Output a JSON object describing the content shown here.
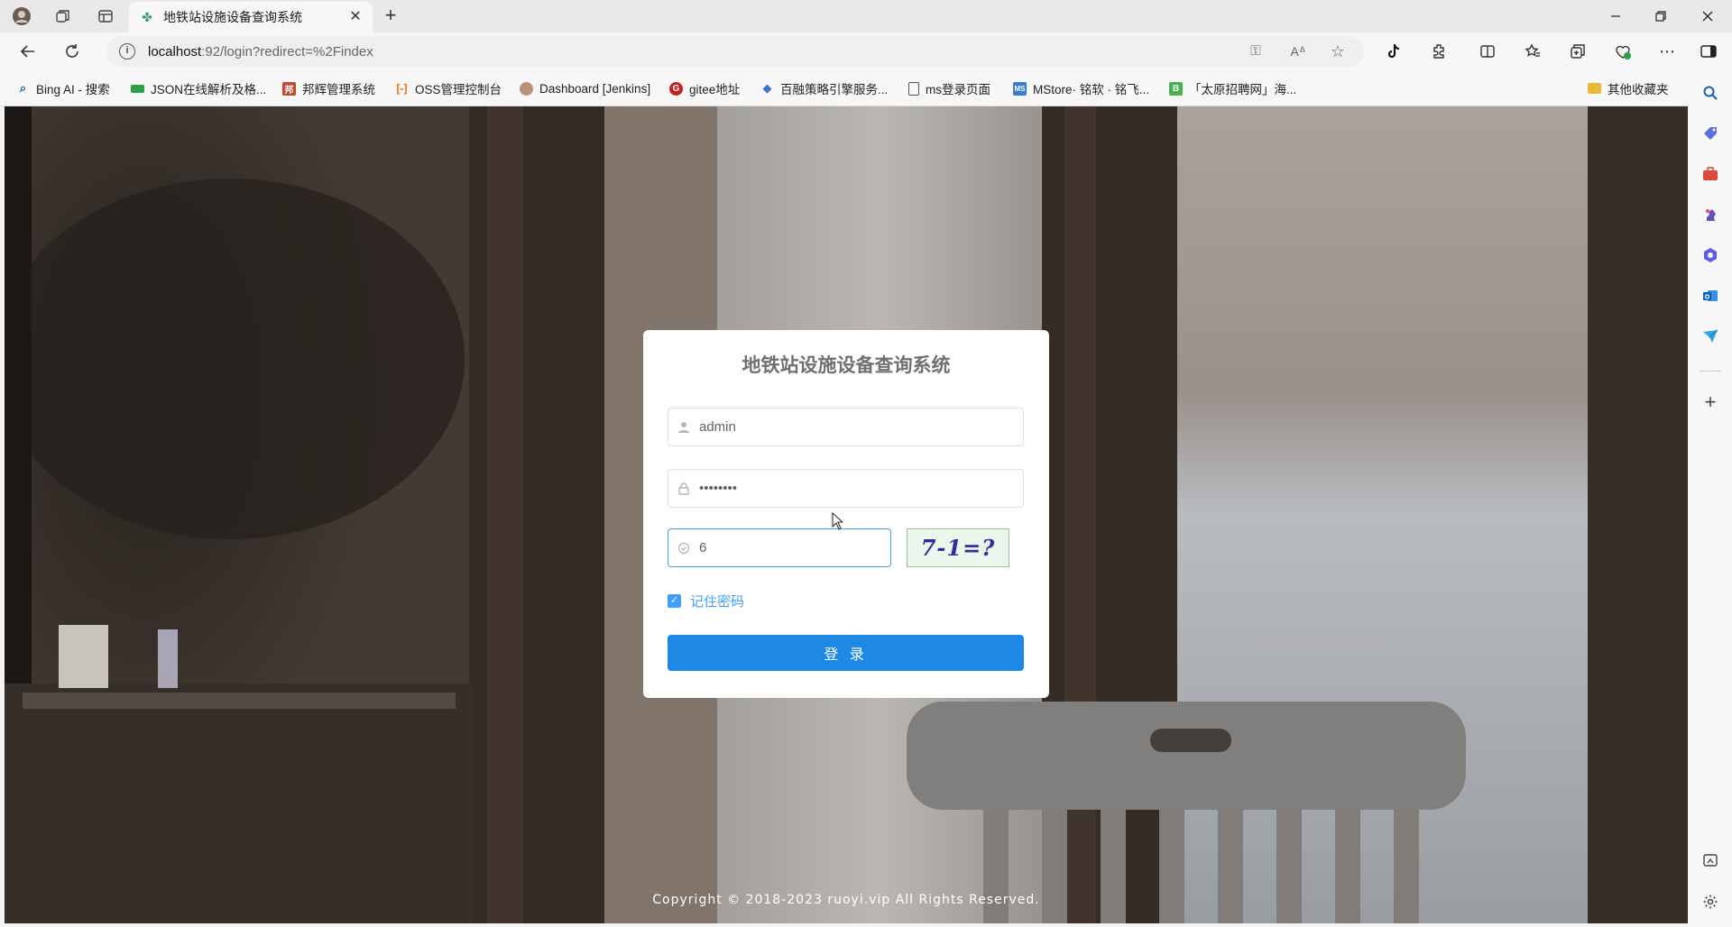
{
  "browser": {
    "tab_title": "地铁站设施设备查询系统",
    "address": {
      "host": "localhost",
      "rest": ":92/login?redirect=%2Findex"
    },
    "bookmarks": [
      {
        "label": "Bing AI - 搜索",
        "icon": "search-icon",
        "color": "#1a5fb4"
      },
      {
        "label": "JSON在线解析及格...",
        "icon": "json-icon",
        "color": "#2ea043"
      },
      {
        "label": "邦辉管理系统",
        "icon": "app-icon",
        "color": "#c4472f"
      },
      {
        "label": "OSS管理控制台",
        "icon": "aliyun-icon",
        "color": "#ff6a00"
      },
      {
        "label": "Dashboard [Jenkins]",
        "icon": "jenkins-icon",
        "color": "#6b4a3a"
      },
      {
        "label": "gitee地址",
        "icon": "gitee-icon",
        "color": "#c71d23"
      },
      {
        "label": "百融策略引擎服务...",
        "icon": "engine-icon",
        "color": "#3377cc"
      },
      {
        "label": "ms登录页面",
        "icon": "page-icon",
        "color": "#555555"
      },
      {
        "label": "MStore· 铭软 · 铭飞...",
        "icon": "mstore-icon",
        "color": "#3a7bd5"
      },
      {
        "label": "「太原招聘网」海...",
        "icon": "b-icon",
        "color": "#4caf50"
      }
    ],
    "other_bookmarks": "其他收藏夹"
  },
  "login": {
    "title": "地铁站设施设备查询系统",
    "username": "admin",
    "password": "••••••••",
    "code": "6",
    "captcha_text": "7-1=?",
    "remember_label": "记住密码",
    "remember_checked": true,
    "submit_label": "登 录"
  },
  "footer": {
    "copyright": "Copyright © 2018-2023 ruoyi.vip All Rights Reserved."
  },
  "colors": {
    "primary": "#1e88e5",
    "accent": "#409eff"
  }
}
